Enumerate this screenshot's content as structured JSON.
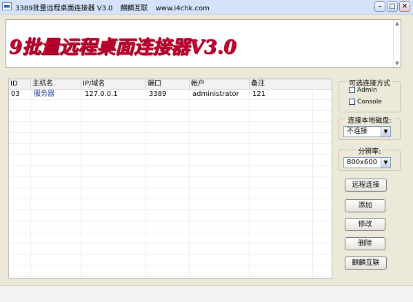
{
  "window": {
    "title": "3389批量远程桌面连接器 V3.0",
    "title_extra": "麒麟互联",
    "title_url": "www.i4chk.com",
    "minimize": "–",
    "maximize": "□",
    "close": "✕"
  },
  "banner": {
    "text": "9批量远程桌面连接器V3.0"
  },
  "table": {
    "columns": [
      "ID",
      "主机名",
      "IP/域名",
      "端口",
      "帐户",
      "备注"
    ],
    "rows": [
      {
        "id": "03",
        "name": "服务器",
        "ip": "127.0.0.1",
        "port": "3389",
        "account": "administrator",
        "note": "121"
      }
    ]
  },
  "connection_mode": {
    "title": "可选连接方式",
    "options": [
      "Admin",
      "Console"
    ]
  },
  "local_disk": {
    "title": "连接本地磁盘:",
    "value": "不连接"
  },
  "resolution": {
    "title": "分辨率:",
    "value": "800x600"
  },
  "buttons": {
    "connect": "远程连接",
    "add": "添加",
    "edit": "修改",
    "delete": "删除",
    "about": "麒麟互联"
  },
  "colors": {
    "banner_text": "#c0002e",
    "hostname_text": "#1a3da3"
  }
}
